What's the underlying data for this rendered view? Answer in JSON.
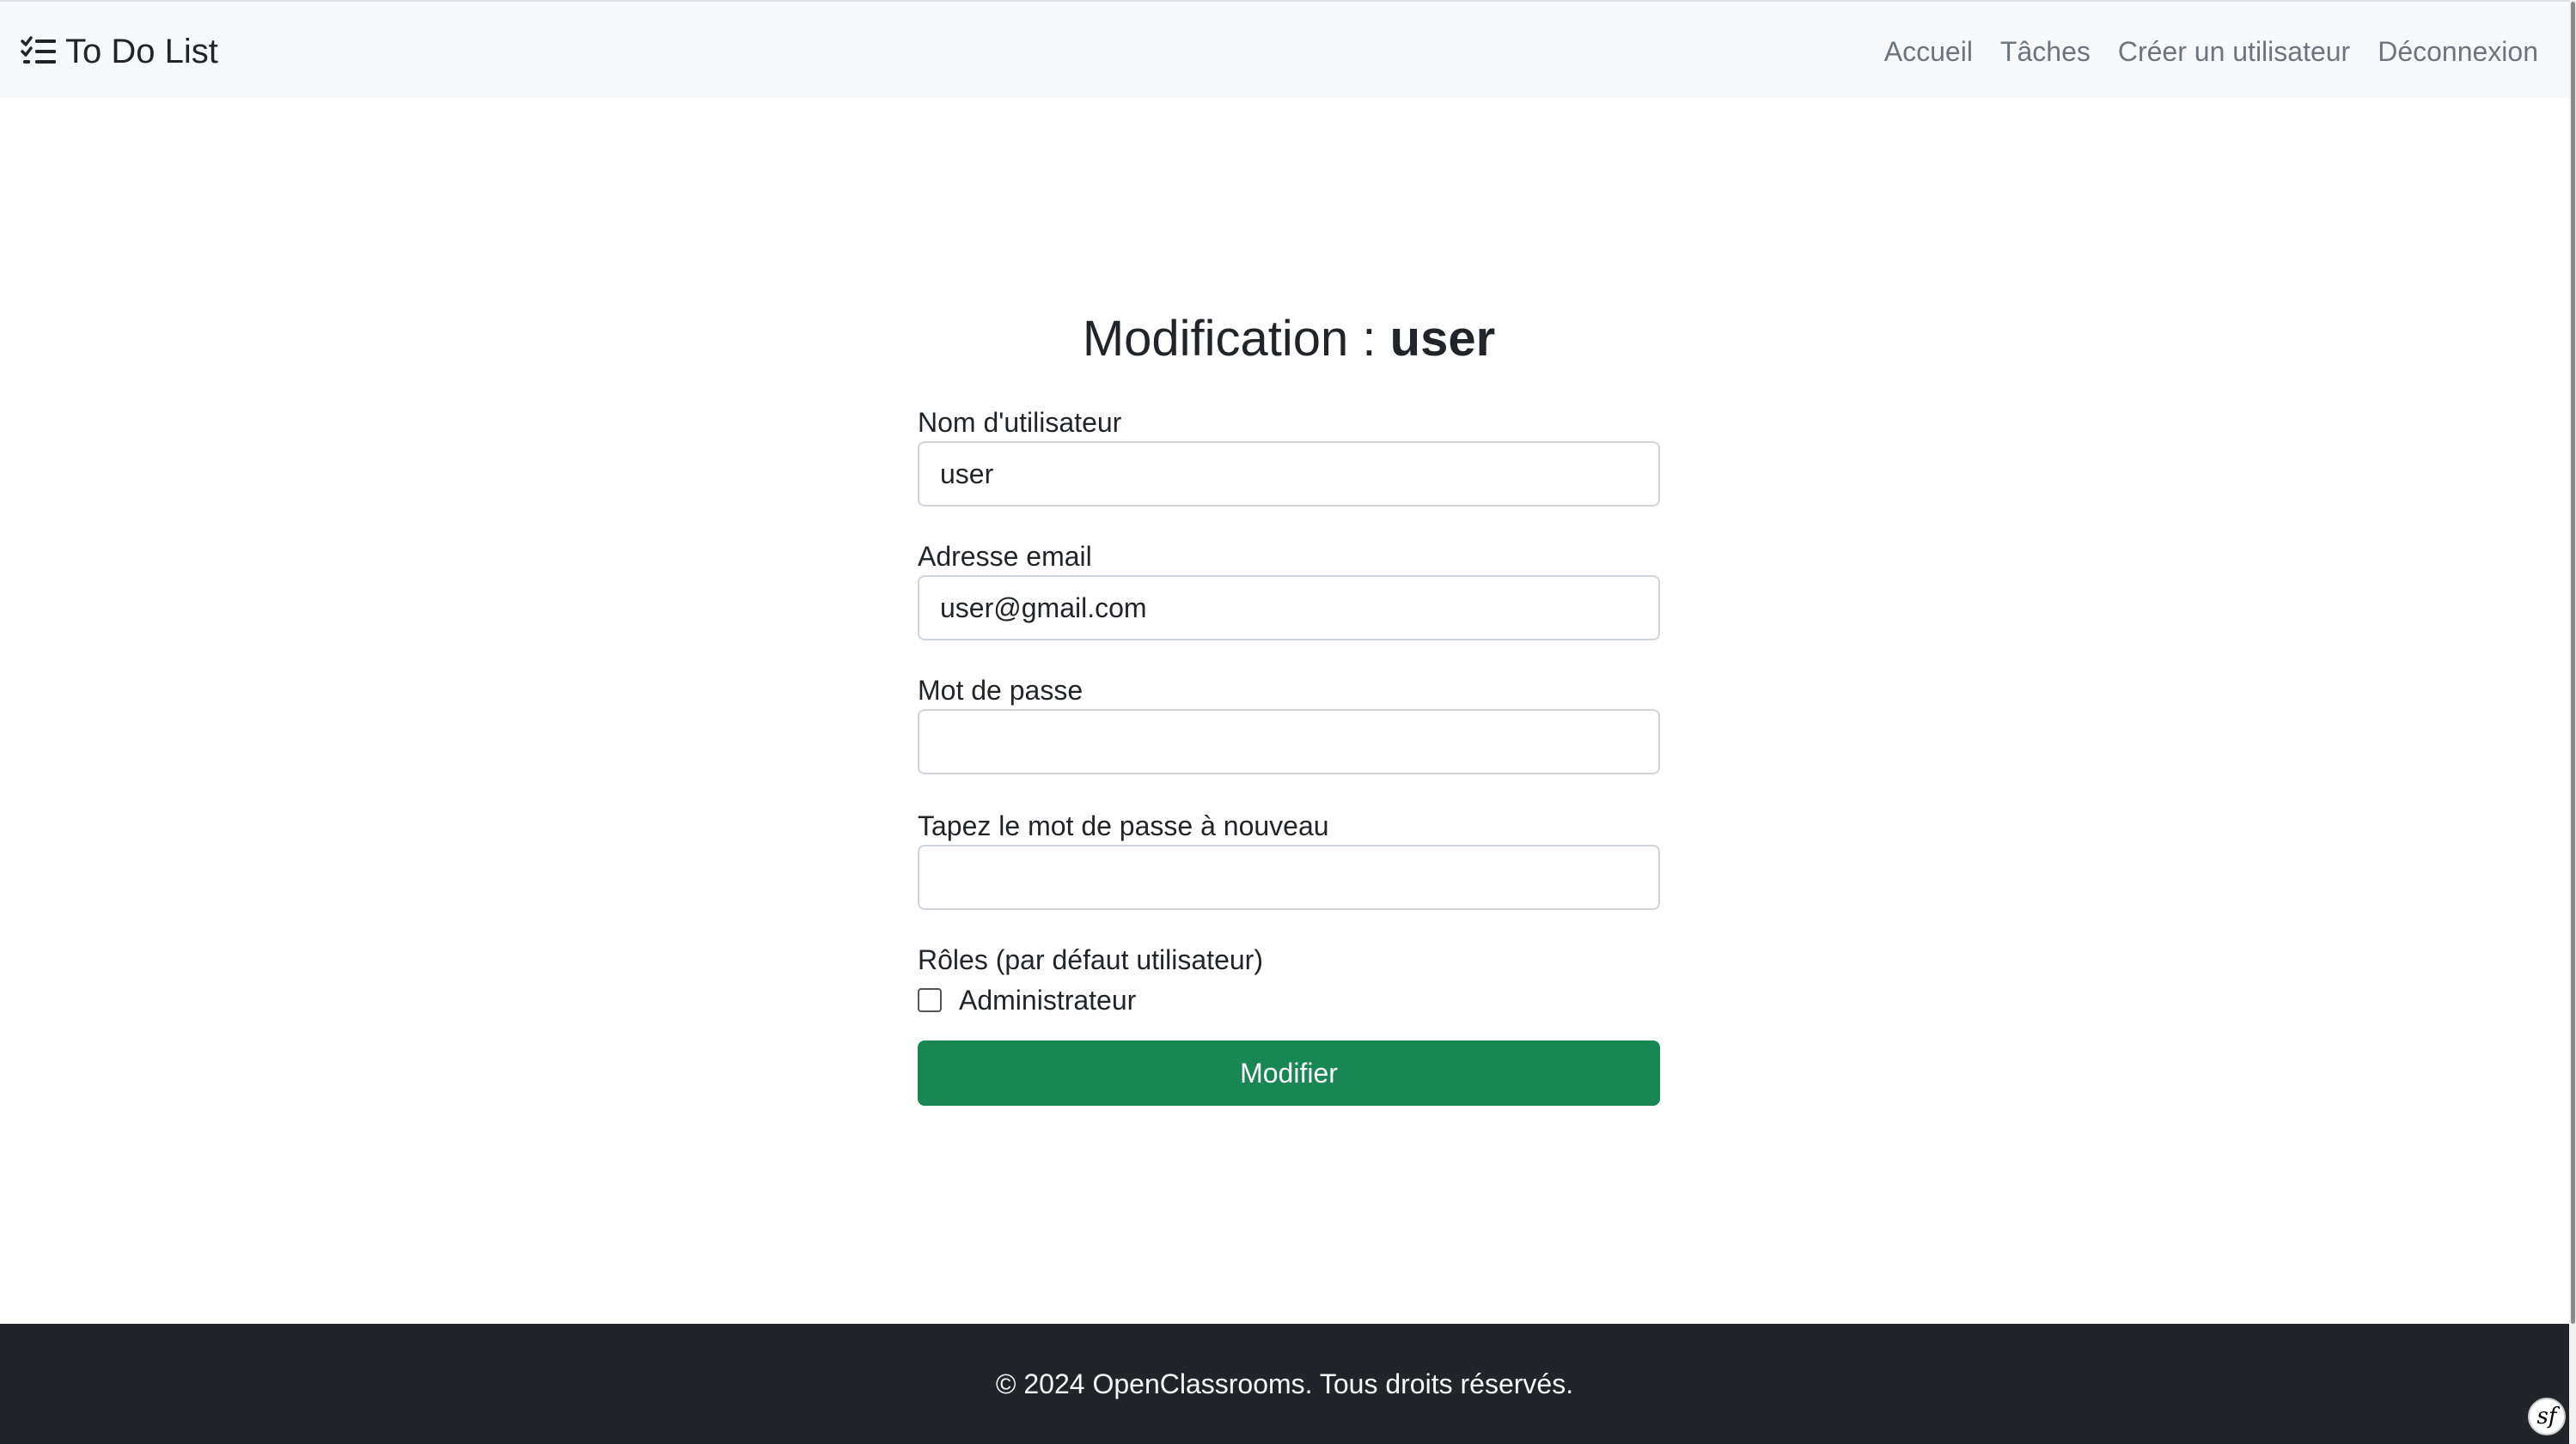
{
  "navbar": {
    "brand": "To Do List",
    "brand_icon": "checklist-icon",
    "links": [
      "Accueil",
      "Tâches",
      "Créer un utilisateur",
      "Déconnexion"
    ]
  },
  "form": {
    "title_prefix": "Modification : ",
    "title_user": "user",
    "username_label": "Nom d'utilisateur",
    "username_value": "user",
    "email_label": "Adresse email",
    "email_value": "user@gmail.com",
    "password_label": "Mot de passe",
    "password_value": "",
    "password_repeat_label": "Tapez le mot de passe à nouveau",
    "password_repeat_value": "",
    "roles_label": "Rôles (par défaut utilisateur)",
    "admin_label": "Administrateur",
    "admin_checked": false,
    "submit_label": "Modifier"
  },
  "footer": {
    "text": "© 2024 OpenClassrooms. Tous droits réservés.",
    "badge": "sf"
  },
  "colors": {
    "navbar_bg": "#f8f9fa",
    "primary_button": "#198754",
    "footer_bg": "#212529"
  }
}
